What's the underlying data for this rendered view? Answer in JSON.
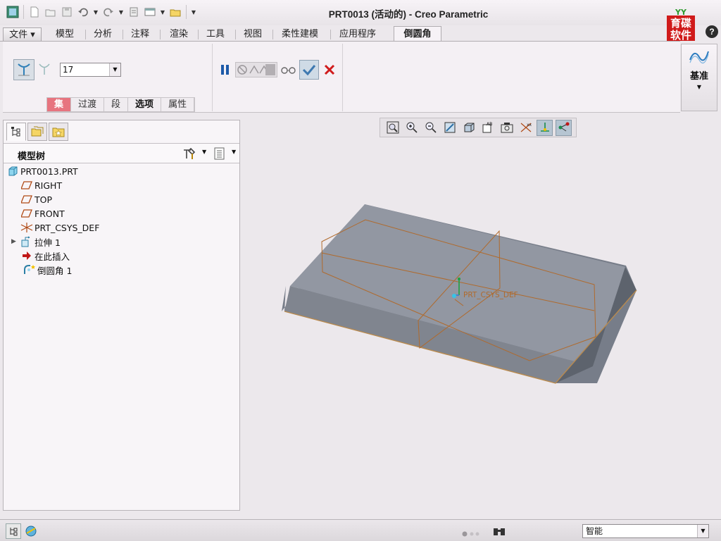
{
  "window": {
    "title": "PRT0013 (活动的) - Creo Parametric"
  },
  "logo": {
    "text": "育碟软件",
    "color": "#d01a1a"
  },
  "help": {
    "label": "?"
  },
  "tabs": [
    {
      "label": "文件 ▾"
    },
    {
      "label": "模型"
    },
    {
      "label": "分析"
    },
    {
      "label": "注释"
    },
    {
      "label": "渲染"
    },
    {
      "label": "工具"
    },
    {
      "label": "视图"
    },
    {
      "label": "柔性建模"
    },
    {
      "label": "应用程序"
    },
    {
      "label": "倒圆角"
    }
  ],
  "active_tab": "倒圆角",
  "round": {
    "radius_value": "17",
    "subtabs": [
      "集",
      "过渡",
      "段",
      "选项",
      "属性"
    ],
    "highlight_color": "#e7747f"
  },
  "datum": {
    "label": "基准"
  },
  "model_tree": {
    "heading": "模型树",
    "items": [
      {
        "label": "PRT0013.PRT",
        "icon": "part-icon"
      },
      {
        "label": "RIGHT",
        "icon": "datum-plane-icon"
      },
      {
        "label": "TOP",
        "icon": "datum-plane-icon"
      },
      {
        "label": "FRONT",
        "icon": "datum-plane-icon"
      },
      {
        "label": "PRT_CSYS_DEF",
        "icon": "csys-icon"
      },
      {
        "label": "拉伸 1",
        "icon": "extrude-icon"
      },
      {
        "label": "在此插入",
        "icon": "insert-here-arrow-icon"
      },
      {
        "label": "倒圆角 1",
        "icon": "round-icon"
      }
    ]
  },
  "viewport": {
    "csys_label": "PRT_CSYS_DEF",
    "datum_color": "#b06a2c",
    "model_color": "#6f7581"
  },
  "status": {
    "filter_value": "智能"
  }
}
